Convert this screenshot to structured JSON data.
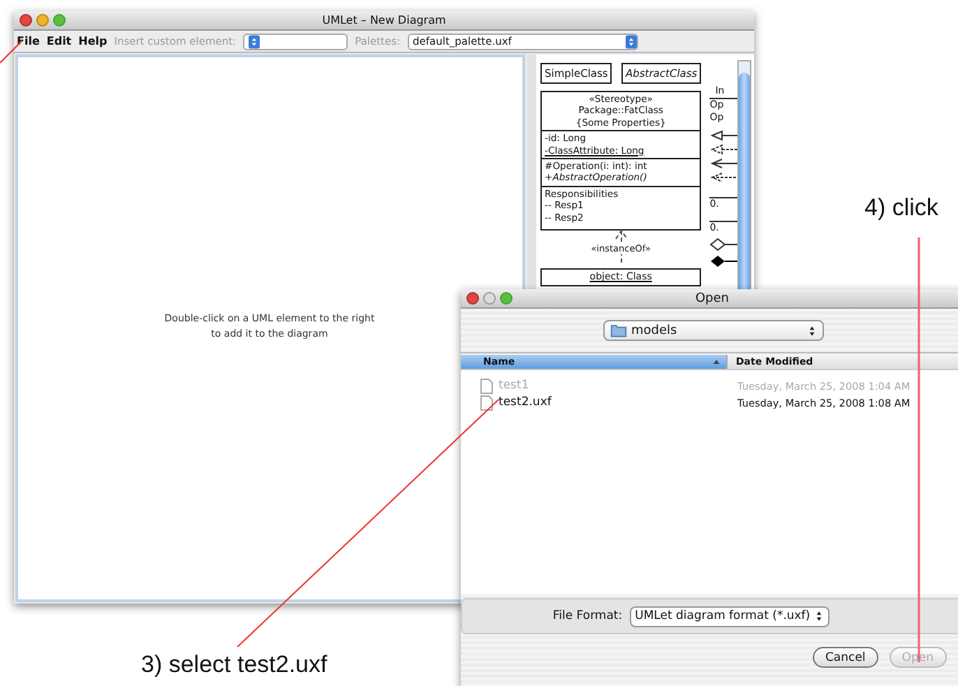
{
  "main_window": {
    "title": "UMLet – New Diagram",
    "menu": [
      "File",
      "Edit",
      "Help"
    ],
    "custom_element_label": "Insert custom element:",
    "palettes_label": "Palettes:",
    "palette_value": "default_palette.uxf",
    "canvas_hint": [
      "Double-click on a UML element to the right",
      "to add it to the diagram"
    ]
  },
  "palette": {
    "simple_class": "SimpleClass",
    "abstract_class": "AbstractClass",
    "fat_class": {
      "header": [
        "«Stereotype»",
        "Package::FatClass",
        "{Some Properties}"
      ],
      "attributes": [
        {
          "text": "-id: Long",
          "static": false
        },
        {
          "text": "-ClassAttribute: Long",
          "static": true
        }
      ],
      "operations": [
        {
          "text": "#Operation(i: int): int",
          "abstract": false
        },
        {
          "text": "+AbstractOperation()",
          "abstract": true
        }
      ],
      "responsibilities": [
        "Responsibilities",
        "-- Resp1",
        "-- Resp2"
      ]
    },
    "relation_label": "«instanceOf»",
    "object": "object: Class",
    "column_2": {
      "title": "In",
      "operations": [
        "Op",
        "Op"
      ],
      "multiplicities": [
        "0.",
        "0."
      ]
    }
  },
  "dialog": {
    "title": "Open",
    "folder": "models",
    "columns": [
      {
        "label": "Name",
        "sorted": true
      },
      {
        "label": "Date Modified",
        "sorted": false
      }
    ],
    "files": [
      {
        "name": "test1",
        "date": "Tuesday, March 25, 2008 1:04 AM",
        "disabled": true
      },
      {
        "name": "test2.uxf",
        "date": "Tuesday, March 25, 2008 1:08 AM",
        "disabled": false
      }
    ],
    "format_label": "File Format:",
    "format_value": "UMLet diagram format (*.uxf)",
    "buttons": [
      {
        "label": "Cancel",
        "disabled": false
      },
      {
        "label": "Open",
        "disabled": true
      }
    ]
  },
  "annotations": [
    {
      "text": "4) click"
    },
    {
      "text": "3) select test2.uxf"
    }
  ]
}
